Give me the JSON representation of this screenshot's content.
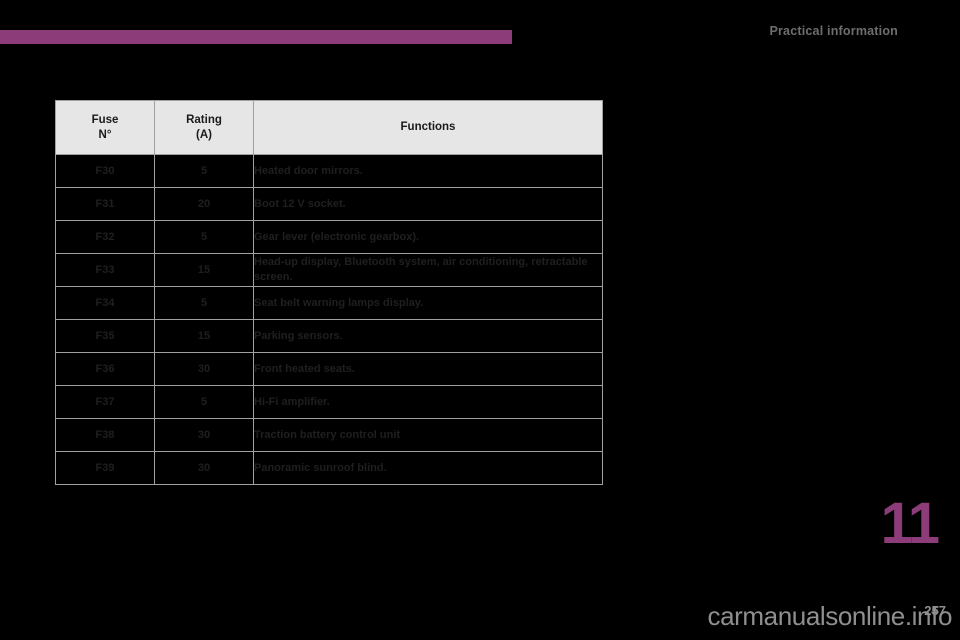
{
  "page": {
    "running_head": "Practical information",
    "chapter_number": "11",
    "folio": "257",
    "watermark": "carmanualsonline.info",
    "accent_color": "#8c3d79",
    "header_bg": "#e6e6e6",
    "body_bg": "#000000"
  },
  "fuse_table": {
    "columns": [
      {
        "key": "fuse",
        "line1": "Fuse",
        "line2": "N°"
      },
      {
        "key": "rating",
        "line1": "Rating",
        "line2": "(A)"
      },
      {
        "key": "functions",
        "line1": "Functions",
        "line2": ""
      }
    ],
    "rows": [
      {
        "fuse": "F30",
        "rating": "5",
        "functions": "Heated door mirrors."
      },
      {
        "fuse": "F31",
        "rating": "20",
        "functions": "Boot 12 V socket."
      },
      {
        "fuse": "F32",
        "rating": "5",
        "functions": "Gear lever (electronic gearbox)."
      },
      {
        "fuse": "F33",
        "rating": "15",
        "functions": "Head-up display, Bluetooth system, air conditioning, retractable screen."
      },
      {
        "fuse": "F34",
        "rating": "5",
        "functions": "Seat belt warning lamps display."
      },
      {
        "fuse": "F35",
        "rating": "15",
        "functions": "Parking sensors."
      },
      {
        "fuse": "F36",
        "rating": "30",
        "functions": "Front heated seats."
      },
      {
        "fuse": "F37",
        "rating": "5",
        "functions": "Hi-Fi amplifier."
      },
      {
        "fuse": "F38",
        "rating": "30",
        "functions": "Traction battery control unit"
      },
      {
        "fuse": "F39",
        "rating": "30",
        "functions": "Panoramic sunroof blind."
      }
    ]
  }
}
